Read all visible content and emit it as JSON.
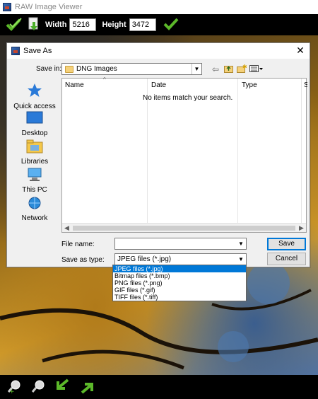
{
  "app": {
    "title": "RAW Image Viewer"
  },
  "toolbar": {
    "width_label": "Width",
    "width_value": "5216",
    "height_label": "Height",
    "height_value": "3472"
  },
  "dialog": {
    "title": "Save As",
    "save_in_label": "Save in:",
    "save_in_value": "DNG Images",
    "places": [
      {
        "label": "Quick access",
        "icon": "star-icon"
      },
      {
        "label": "Desktop",
        "icon": "desktop-icon"
      },
      {
        "label": "Libraries",
        "icon": "libraries-icon"
      },
      {
        "label": "This PC",
        "icon": "computer-icon"
      },
      {
        "label": "Network",
        "icon": "network-icon"
      }
    ],
    "columns": [
      "Name",
      "Date",
      "Type",
      "S"
    ],
    "empty_message": "No items match your search.",
    "file_name_label": "File name:",
    "file_name_value": "",
    "save_as_type_label": "Save as type:",
    "save_as_type_value": "JPEG files (*.jpg)",
    "save_button": "Save",
    "cancel_button": "Cancel",
    "type_options": [
      "JPEG files (*.jpg)",
      "Bitmap files (*.bmp)",
      "PNG files (*.png)",
      "GIF files (*.gif)",
      "TIFF files (*.tiff)"
    ]
  }
}
